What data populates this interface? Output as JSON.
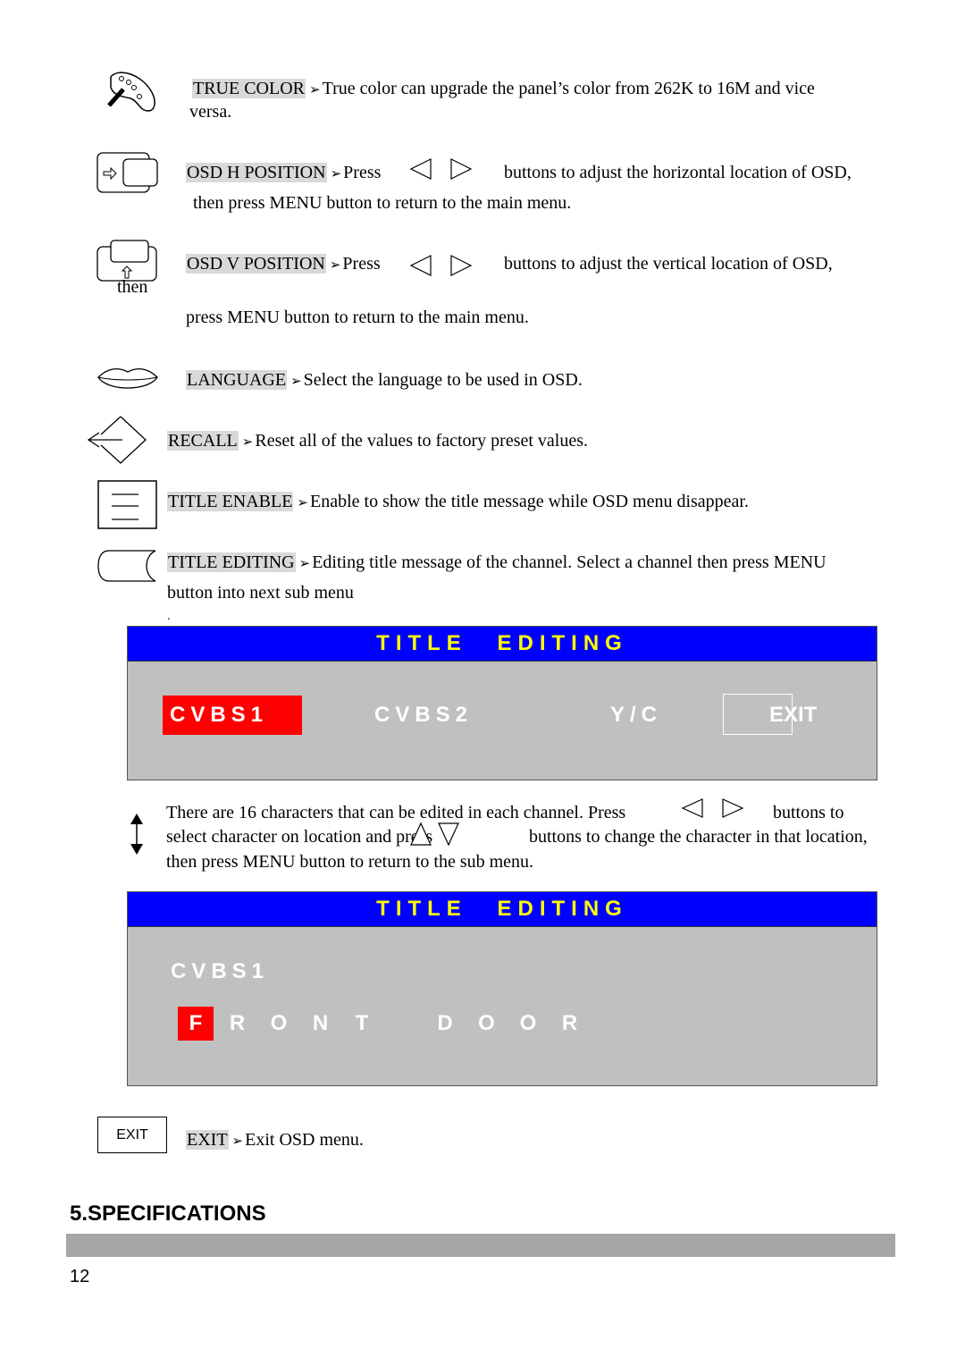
{
  "items": {
    "true_color": {
      "term": "TRUE COLOR",
      "desc": "True color can upgrade the panel’s color from 262K to 16M and vice",
      "desc2": "versa."
    },
    "osd_h": {
      "term": "OSD H POSITION",
      "pre": "Press",
      "post": "buttons to adjust the horizontal location of OSD,",
      "desc2": "then press MENU button to return to the main menu."
    },
    "osd_v": {
      "term": "OSD V POSITION",
      "pre": "Press",
      "post": "buttons to adjust the vertical location of OSD,",
      "stray": "then",
      "desc2": "press MENU button to return to the main menu."
    },
    "language": {
      "term": "LANGUAGE",
      "desc": "Select the language to be used in OSD."
    },
    "recall": {
      "term": "RECALL",
      "desc": "Reset all of the values to factory preset values."
    },
    "title_enable": {
      "term": "TITLE ENABLE",
      "desc": "Enable to show the title message while OSD menu disappear."
    },
    "title_editing": {
      "term": "TITLE EDITING",
      "desc": "Editing title message of the channel. Select a channel then press MENU",
      "desc2": "button into next sub menu",
      "dot": "."
    },
    "exit": {
      "term": "EXIT",
      "desc": "Exit OSD menu.",
      "icon_label": "EXIT"
    }
  },
  "bullet": "➢",
  "osd1": {
    "title": "TITLE EDITING",
    "options": [
      "CVBS1",
      "CVBS2",
      "Y/C",
      "EXIT"
    ],
    "selected": "CVBS1"
  },
  "instructions": {
    "line1a": "There are 16 characters that can be edited in each channel. Press",
    "line1b": "buttons to",
    "line2a": "select character on location and press",
    "line2b": "buttons to change the character in that location,",
    "line3": "then press MENU button to return to the sub menu."
  },
  "osd2": {
    "title": "TITLE EDITING",
    "channel": "CVBS1",
    "chars": [
      "F",
      "R",
      "O",
      "N",
      "T",
      " ",
      "D",
      "O",
      "O",
      "R"
    ],
    "cursor_index": 0
  },
  "section_heading": "5.SPECIFICATIONS",
  "page_number": "12",
  "colors": {
    "osd_header": "#0000ff",
    "osd_title": "#ffff00",
    "osd_body": "#c0c0c0",
    "highlight": "#ff0000"
  }
}
